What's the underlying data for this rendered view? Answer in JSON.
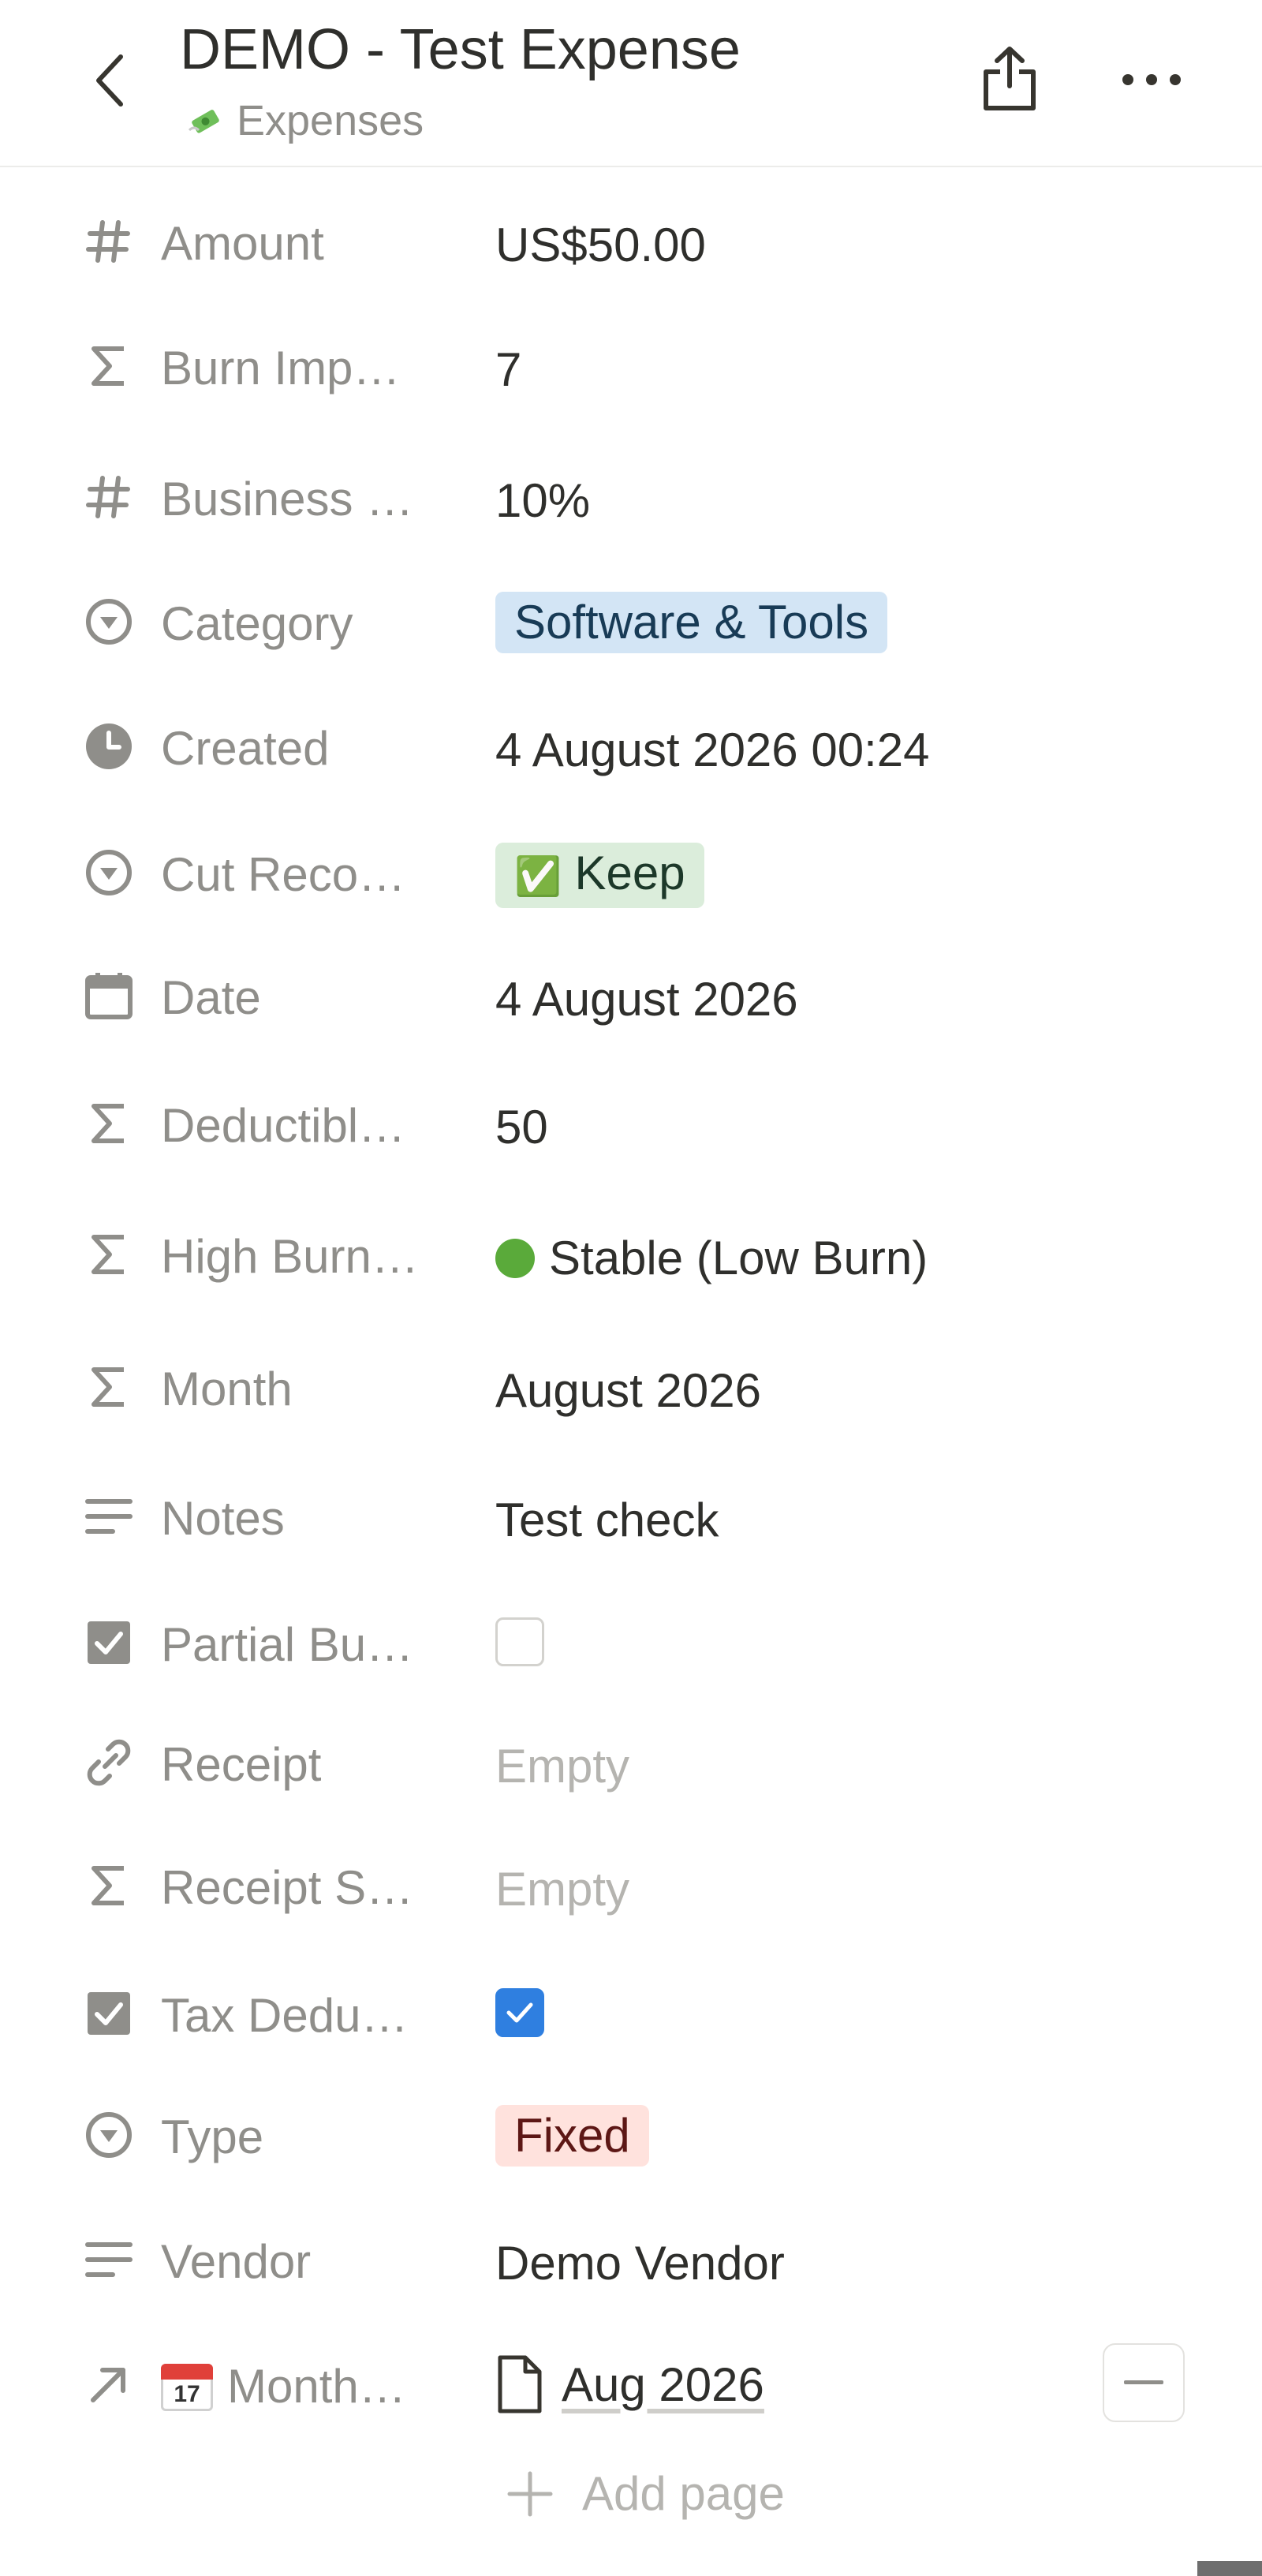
{
  "header": {
    "title": "DEMO - Test Expense",
    "breadcrumb_icon": "money-with-wings-emoji",
    "breadcrumb": "Expenses",
    "icons": {
      "back": "chevron-left-icon",
      "share": "share-icon",
      "more": "more-horizontal-icon"
    }
  },
  "properties": [
    {
      "label": "Amount",
      "icon": "number-icon",
      "value": "US$50.00"
    },
    {
      "label": "Burn Imp…",
      "icon": "formula-icon",
      "value": "7"
    },
    {
      "label": "Business …",
      "icon": "number-icon",
      "value": "10%"
    },
    {
      "label": "Category",
      "icon": "select-icon",
      "value": "Software & Tools",
      "tag_color": "#d3e5f5"
    },
    {
      "label": "Created",
      "icon": "clock-icon",
      "value": "4 August 2026 00:24"
    },
    {
      "label": "Cut Reco…",
      "icon": "select-icon",
      "value_emoji": "✅",
      "value": "Keep",
      "tag_color": "#dbeddb"
    },
    {
      "label": "Date",
      "icon": "calendar-icon",
      "value": "4 August 2026"
    },
    {
      "label": "Deductibl…",
      "icon": "formula-icon",
      "value": "50"
    },
    {
      "label": "High Burn…",
      "icon": "formula-icon",
      "value_emoji": "🟢",
      "value": "Stable (Low Burn)"
    },
    {
      "label": "Month",
      "icon": "formula-icon",
      "value": "August 2026"
    },
    {
      "label": "Notes",
      "icon": "text-icon",
      "value": "Test check"
    },
    {
      "label": "Partial Bu…",
      "icon": "checkbox-icon",
      "checked": false
    },
    {
      "label": "Receipt",
      "icon": "link-icon",
      "value": "Empty"
    },
    {
      "label": "Receipt S…",
      "icon": "formula-icon",
      "value": "Empty"
    },
    {
      "label": "Tax Dedu…",
      "icon": "checkbox-icon",
      "checked": true
    },
    {
      "label": "Type",
      "icon": "select-icon",
      "value": "Fixed",
      "tag_color": "#ffe2dd"
    },
    {
      "label": "Vendor",
      "icon": "text-icon",
      "value": "Demo Vendor"
    },
    {
      "label": "Month…",
      "label_emoji": "📅",
      "icon": "relation-icon",
      "value": "Aug 2026",
      "value_icon": "page-icon"
    }
  ],
  "add_page": "Add page",
  "colors": {
    "accent_blue": "#2f7fe0",
    "label_gray": "#8f8e8a",
    "text": "#2f2f2c"
  }
}
